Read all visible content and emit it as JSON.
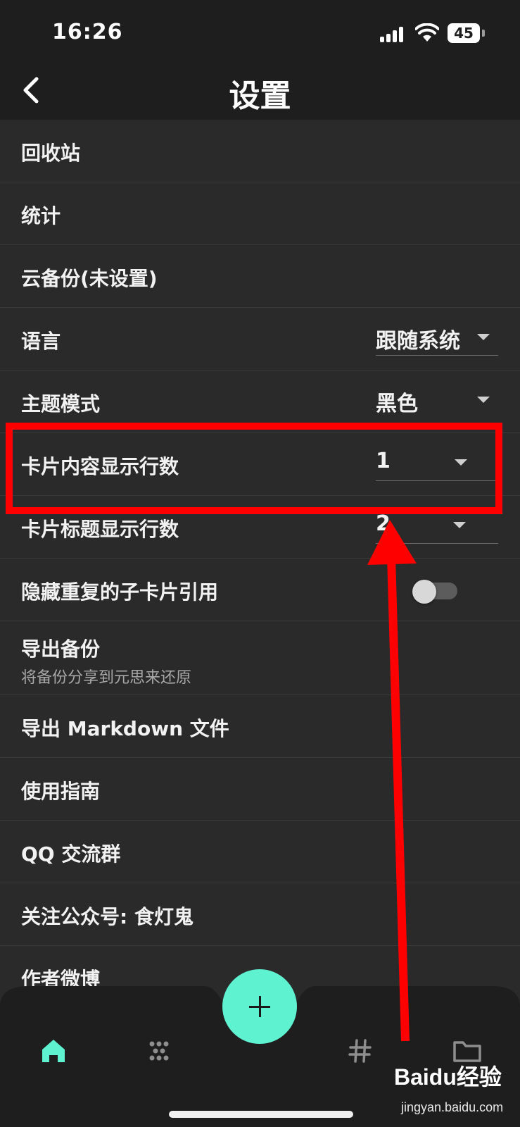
{
  "status": {
    "time": "16:26",
    "battery": "45"
  },
  "header": {
    "title": "设置"
  },
  "rows": [
    {
      "label": "回收站"
    },
    {
      "label": "统计"
    },
    {
      "label": "云备份(未设置)"
    },
    {
      "label": "语言",
      "value": "跟随系统"
    },
    {
      "label": "主题模式",
      "value": "黑色"
    },
    {
      "label": "卡片内容显示行数",
      "value": "1"
    },
    {
      "label": "卡片标题显示行数",
      "value": "2"
    },
    {
      "label": "隐藏重复的子卡片引用",
      "toggle": false
    },
    {
      "label": "导出备份",
      "sub": "将备份分享到元思来还原"
    },
    {
      "label": "导出 Markdown 文件"
    },
    {
      "label": "使用指南"
    },
    {
      "label": "QQ 交流群"
    },
    {
      "label": "关注公众号: 食灯鬼"
    },
    {
      "label": "作者微博"
    }
  ],
  "nav": {
    "active": "home",
    "items": [
      "home-icon",
      "grid-dots-icon",
      "hashtag-icon",
      "folder-icon"
    ]
  },
  "colors": {
    "accent": "#5ff2d1",
    "highlight": "#ff0000",
    "background": "#2a2a2a",
    "bar": "#1e1e1e"
  },
  "watermark": {
    "brand": "Baidu经验",
    "site": "jingyan.baidu.com"
  }
}
